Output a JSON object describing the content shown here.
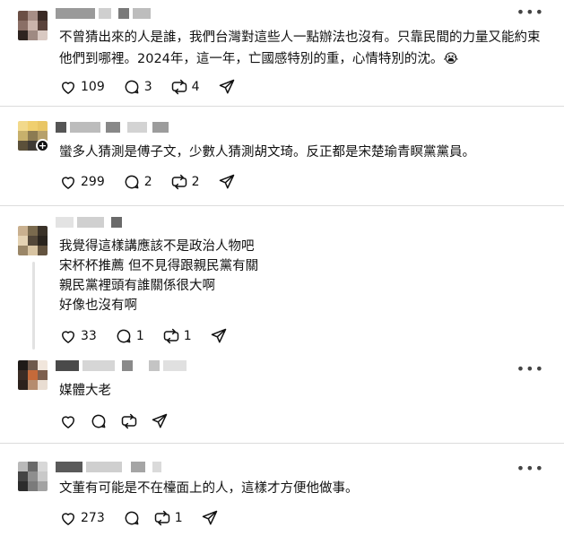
{
  "posts": [
    {
      "text": "不曾猜出來的人是誰，我們台灣對這些人一點辦法也沒有。只靠民間的力量又能約束他們到哪裡。2024年，這一年，亡國感特別的重，心情特別的沈。😭",
      "likes": "109",
      "comments": "3",
      "reposts": "4",
      "avatar_colors": [
        "#6b4f45",
        "#a78e86",
        "#3b2b26",
        "#8a6f66",
        "#cbb4ab",
        "#5a433b",
        "#2e2420",
        "#9f8a82",
        "#d9c9c2"
      ]
    },
    {
      "text": "蠻多人猜測是傅子文，少數人猜測胡文琦。反正都是宋楚瑜青瞑黨黨員。",
      "likes": "299",
      "comments": "2",
      "reposts": "2",
      "avatar_colors": [
        "#f2d98b",
        "#f0cf6f",
        "#e9c665",
        "#c7b06c",
        "#8c7b52",
        "#b6a06a",
        "#5b503a",
        "#3e3a34",
        "#9b8e6d"
      ]
    },
    {
      "text": "我覺得這樣講應該不是政治人物吧\n宋杯杯推薦 但不見得跟親民黨有關\n親民黨裡頭有誰關係很大啊\n好像也沒有啊",
      "likes": "33",
      "comments": "1",
      "reposts": "1",
      "avatar_colors": [
        "#c9b08f",
        "#7a6a4e",
        "#3a3228",
        "#e4d2b3",
        "#54483a",
        "#2a241e",
        "#9a8667",
        "#d8c4a2",
        "#63533f"
      ]
    },
    {
      "text": "媒體大老",
      "likes": "",
      "comments": "",
      "reposts": "",
      "avatar_colors": [
        "#1e1a18",
        "#6f5a4d",
        "#f1e6dc",
        "#3a2c25",
        "#c56a3a",
        "#7d5f4e",
        "#2b211c",
        "#b58c6f",
        "#e9ddd2"
      ]
    },
    {
      "text": "文董有可能是不在檯面上的人，這樣才方便他做事。",
      "likes": "273",
      "comments": "",
      "reposts": "1",
      "avatar_colors": [
        "#b9b9b9",
        "#6a6a6a",
        "#d8d8d8",
        "#444444",
        "#8e8e8e",
        "#c9c9c9",
        "#2c2c2c",
        "#7b7b7b",
        "#a3a3a3"
      ]
    }
  ]
}
